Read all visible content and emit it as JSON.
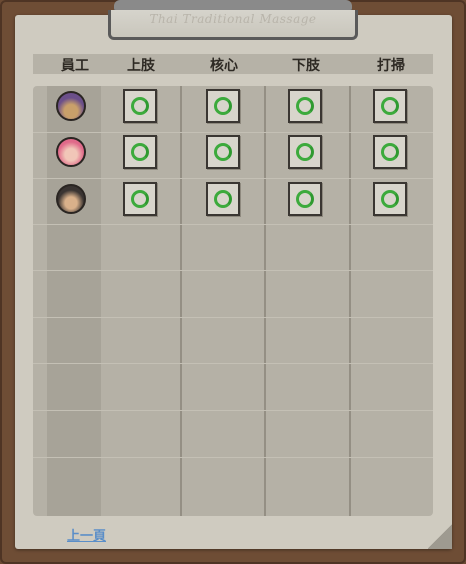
{
  "clipboard": {
    "title": "Thai Traditional Massage"
  },
  "headers": {
    "staff": "員工",
    "upper": "上肢",
    "core": "核心",
    "lower": "下肢",
    "cleaning": "打掃"
  },
  "rows": [
    {
      "avatar_icon": "staff-avatar-purple-hair",
      "upper": "complete",
      "core": "complete",
      "lower": "complete",
      "cleaning": "complete"
    },
    {
      "avatar_icon": "staff-avatar-pink-hair",
      "upper": "complete",
      "core": "complete",
      "lower": "complete",
      "cleaning": "complete"
    },
    {
      "avatar_icon": "staff-avatar-dark-hair",
      "upper": "complete",
      "core": "complete",
      "lower": "complete",
      "cleaning": "complete"
    }
  ],
  "navigation": {
    "prev_page": "上一頁"
  },
  "colors": {
    "ring": "#3caa3c",
    "link": "#5a8ec8",
    "board": "#6e4d35"
  }
}
